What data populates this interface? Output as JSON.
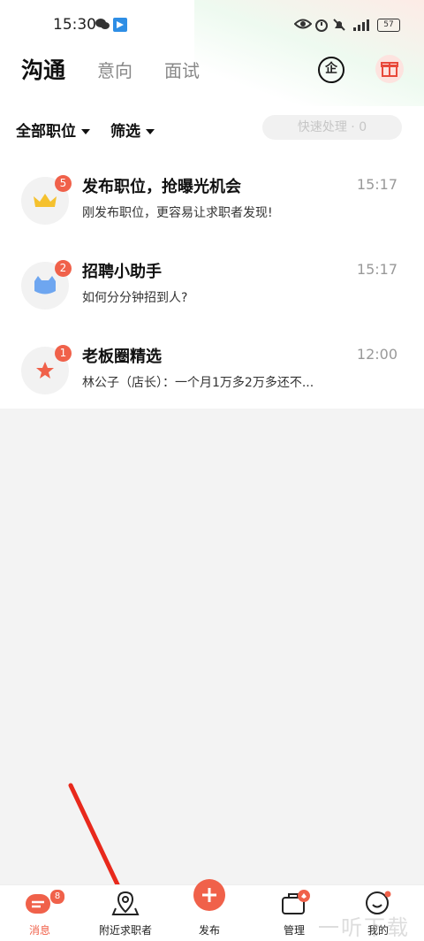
{
  "status_bar": {
    "time": "15:30",
    "battery": "57"
  },
  "header": {
    "tabs": [
      {
        "label": "沟通",
        "active": true
      },
      {
        "label": "意向",
        "active": false
      },
      {
        "label": "面试",
        "active": false
      }
    ],
    "company_icon_label": "企",
    "gift_icon": "gift-icon"
  },
  "filters": {
    "position_label": "全部职位",
    "filter_label": "筛选",
    "quick_process_label": "快速处理 · 0"
  },
  "conversations": [
    {
      "title": "发布职位，抢曝光机会",
      "time": "15:17",
      "preview": "刚发布职位，更容易让求职者发现!",
      "badge": "5",
      "icon": "crown-icon"
    },
    {
      "title": "招聘小助手",
      "time": "15:17",
      "preview": "如何分分钟招到人?",
      "badge": "2",
      "icon": "cat-icon"
    },
    {
      "title": "老板圈精选",
      "time": "12:00",
      "preview": "林公子（店长）：一个月1万多2万多还不...",
      "badge": "1",
      "icon": "star-icon"
    }
  ],
  "bottom_nav": [
    {
      "label": "消息",
      "badge": "8",
      "active": true
    },
    {
      "label": "附近求职者",
      "active": false
    },
    {
      "label": "发布",
      "active": false
    },
    {
      "label": "管理",
      "active": false
    },
    {
      "label": "我的",
      "active": false
    }
  ],
  "watermark": "一听下载",
  "colors": {
    "accent": "#f0614a",
    "active_nav": "#f0614a",
    "arrow": "#e8291c"
  }
}
